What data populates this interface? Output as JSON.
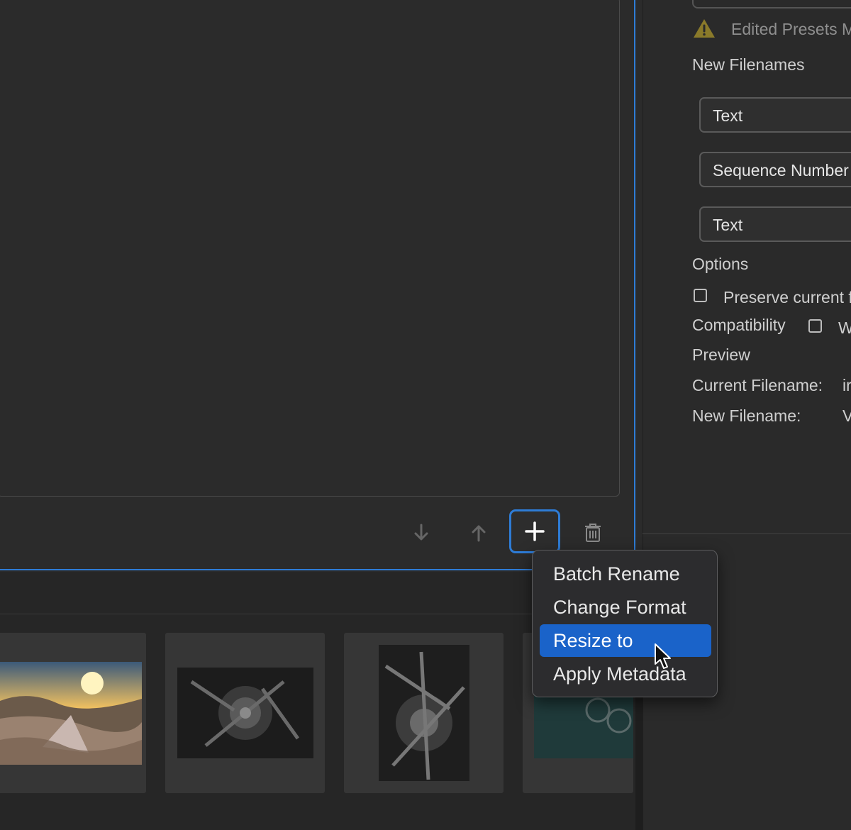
{
  "right_panel": {
    "warning_text": "Edited Presets M",
    "new_filenames_label": "New Filenames",
    "filename_parts": [
      "Text",
      "Sequence Number",
      "Text"
    ],
    "options_label": "Options",
    "preserve_label": "Preserve current f",
    "compatibility_label": "Compatibility",
    "compat_option": "W",
    "preview_label": "Preview",
    "current_filename_label": "Current Filename:",
    "current_filename_value": "ir",
    "new_filename_label": "New Filename:",
    "new_filename_value": "V"
  },
  "toolbar": {
    "move_down_icon": "arrow-down-icon",
    "move_up_icon": "arrow-up-icon",
    "add_icon": "plus-icon",
    "delete_icon": "trash-icon"
  },
  "context_menu": {
    "items": [
      "Batch Rename",
      "Change Format",
      "Resize to",
      "Apply Metadata"
    ],
    "selected": "Resize to"
  },
  "colors": {
    "accent": "#2e7cd6",
    "selection": "#1a63c9",
    "warning": "#8a7a2a"
  }
}
